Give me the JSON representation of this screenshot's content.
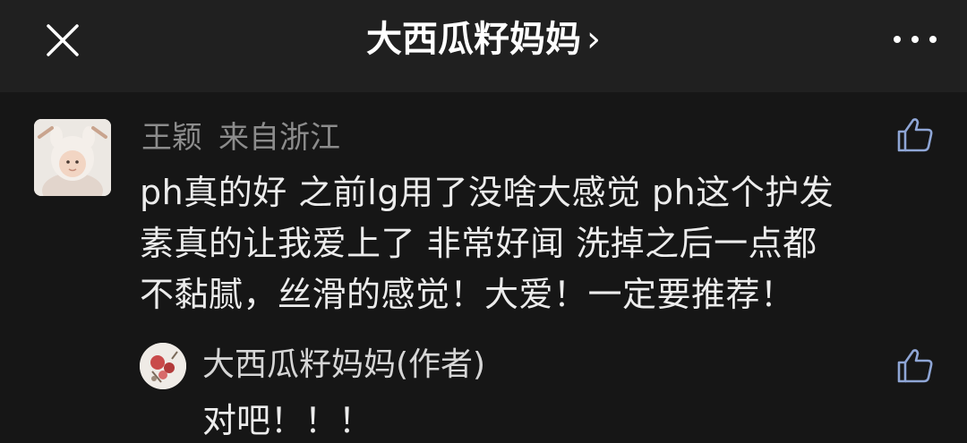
{
  "header": {
    "title": "大西瓜籽妈妈",
    "chevron": "›",
    "close_icon": "close-icon",
    "more_icon": "more-icon"
  },
  "comment": {
    "author": "王颖",
    "location": "来自浙江",
    "lines": [
      "ph真的好 之前lg用了没啥大感觉 ph这个护发",
      "素真的让我爱上了 非常好闻 洗掉之后一点都",
      "不黏腻，丝滑的感觉！大爱！一定要推荐！"
    ],
    "like_icon": "thumbs-up-icon"
  },
  "reply": {
    "author": "大西瓜籽妈妈(作者)",
    "text": "对吧！！！",
    "like_icon": "thumbs-up-icon"
  },
  "colors": {
    "background": "#161616",
    "header_background": "#202020",
    "primary_text": "#ececec",
    "secondary_text": "#8c8c8c"
  }
}
